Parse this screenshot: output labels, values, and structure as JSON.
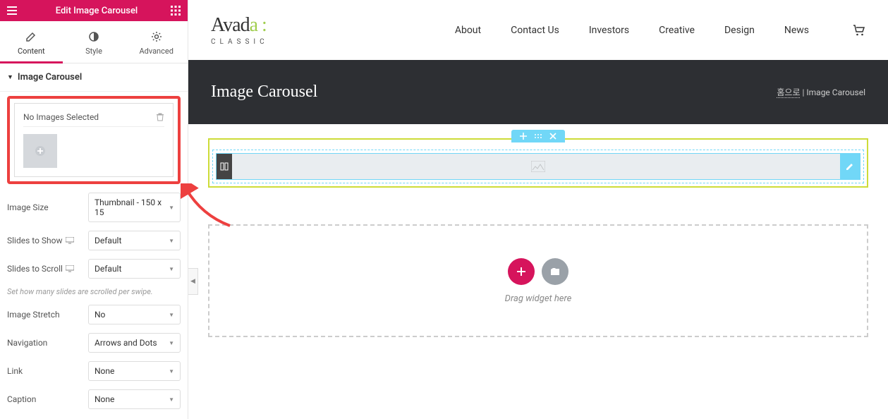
{
  "sidebar": {
    "header_title": "Edit Image Carousel",
    "tabs": {
      "content": "Content",
      "style": "Style",
      "advanced": "Advanced"
    },
    "section_title": "Image Carousel",
    "image_box": {
      "label": "No Images Selected"
    },
    "controls": {
      "image_size": {
        "label": "Image Size",
        "value": "Thumbnail - 150 x 15"
      },
      "slides_to_show": {
        "label": "Slides to Show",
        "value": "Default"
      },
      "slides_to_scroll": {
        "label": "Slides to Scroll",
        "value": "Default",
        "hint": "Set how many slides are scrolled per swipe."
      },
      "image_stretch": {
        "label": "Image Stretch",
        "value": "No"
      },
      "navigation": {
        "label": "Navigation",
        "value": "Arrows and Dots"
      },
      "link": {
        "label": "Link",
        "value": "None"
      },
      "caption": {
        "label": "Caption",
        "value": "None"
      }
    }
  },
  "header": {
    "brand_main": "Avad",
    "brand_accent": "a",
    "brand_colon": " :",
    "brand_sub": "CLASSIC",
    "nav": [
      "About",
      "Contact Us",
      "Investors",
      "Creative",
      "Design",
      "News"
    ]
  },
  "hero": {
    "title": "Image Carousel",
    "breadcrumb_home": "홈으로",
    "breadcrumb_sep": " | ",
    "breadcrumb_current": "Image Carousel"
  },
  "dropzone": {
    "text": "Drag widget here"
  }
}
